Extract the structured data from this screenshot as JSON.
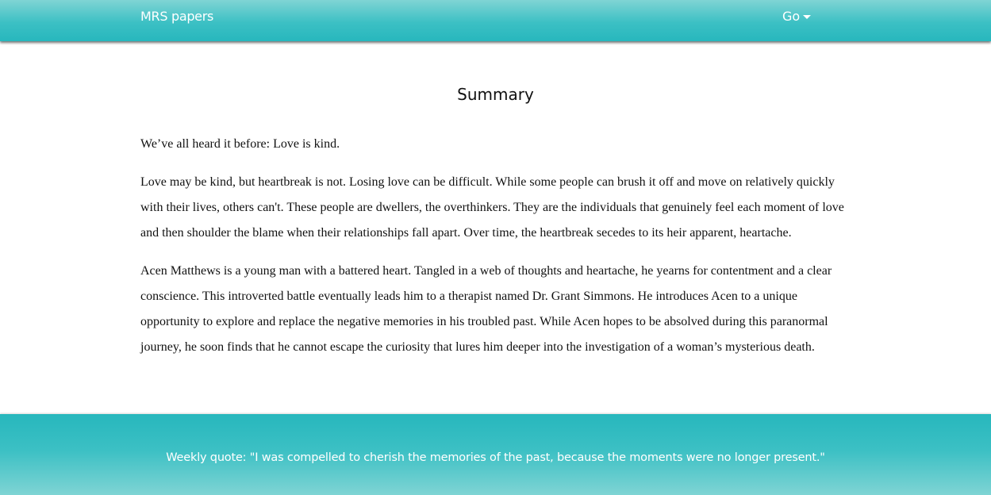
{
  "navbar": {
    "brand": "MRS papers",
    "menu_label": "Go",
    "menu_icon": "caret-down-icon"
  },
  "main": {
    "title": "Summary",
    "paragraphs": [
      "We’ve all heard it before: Love is kind.",
      "Love may be kind, but heartbreak is not. Losing love can be difficult. While some people can brush it off and move on relatively quickly with their lives, others can't. These people are dwellers, the overthinkers. They are the individuals that genuinely feel each moment of love and then shoulder the blame when their relationships fall apart. Over time, the heartbreak secedes to its heir apparent, heartache.",
      "Acen Matthews is a young man with a battered heart. Tangled in a web of thoughts and heartache, he yearns for contentment and a clear conscience. This introverted battle eventually leads him to a therapist named Dr. Grant Simmons. He introduces Acen to a unique opportunity to explore and replace the negative memories in his troubled past. While Acen hopes to be absolved during this paranormal journey, he soon finds that he cannot escape the curiosity that lures him deeper into the investigation of a woman’s mysterious death."
    ]
  },
  "footer": {
    "quote": "Weekly quote: \"I was compelled to cherish the memories of the past, because the moments were no longer present.\""
  },
  "colors": {
    "accent": "#27b7bd",
    "accent_light": "#7fd4d4",
    "text": "#111111"
  }
}
